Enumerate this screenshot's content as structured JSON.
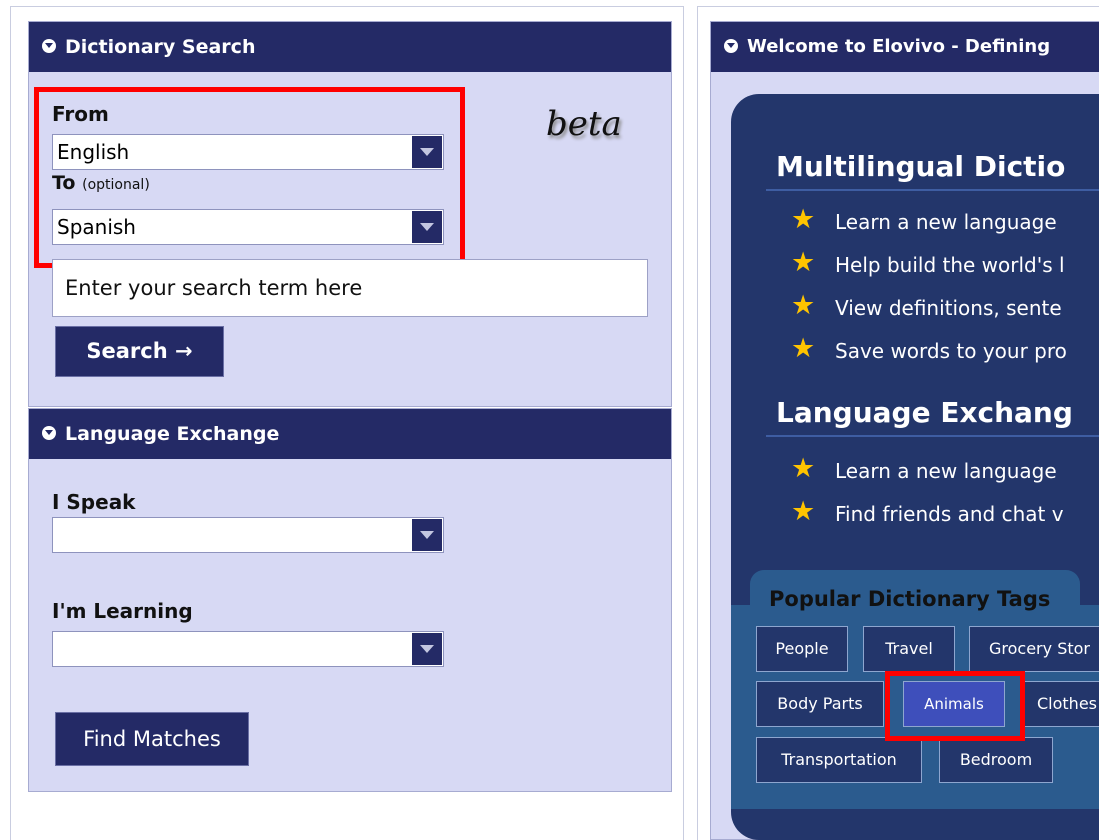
{
  "dictionary_search": {
    "title": "Dictionary Search",
    "from_label": "From",
    "from_value": "English",
    "to_label": "To",
    "to_optional": "(optional)",
    "to_value": "Spanish",
    "beta": "beta",
    "search_placeholder": "Enter your search term here",
    "search_button": "Search →"
  },
  "language_exchange": {
    "title": "Language Exchange",
    "i_speak_label": "I Speak",
    "i_speak_value": "",
    "learning_label": "I'm Learning",
    "learning_value": "",
    "find_matches_button": "Find Matches"
  },
  "welcome": {
    "title": "Welcome to Elovivo - Defining",
    "multilingual_heading": "Multilingual Dictio",
    "multilingual_items": [
      "Learn a new language",
      "Help build the world's l",
      "View definitions, sente",
      "Save words to your pro"
    ],
    "exchange_heading": "Language Exchang",
    "exchange_items": [
      "Learn a new language",
      "Find friends and chat v"
    ],
    "tags_title": "Popular Dictionary Tags",
    "tags": [
      "People",
      "Travel",
      "Grocery Stor",
      "Body Parts",
      "Animals",
      "Clothes",
      "Transportation",
      "Bedroom"
    ]
  },
  "colors": {
    "header_navy": "#242a66",
    "panel_lavender": "#d7d9f4",
    "highlight_red": "#ff0000",
    "star_gold": "#ffc400"
  }
}
